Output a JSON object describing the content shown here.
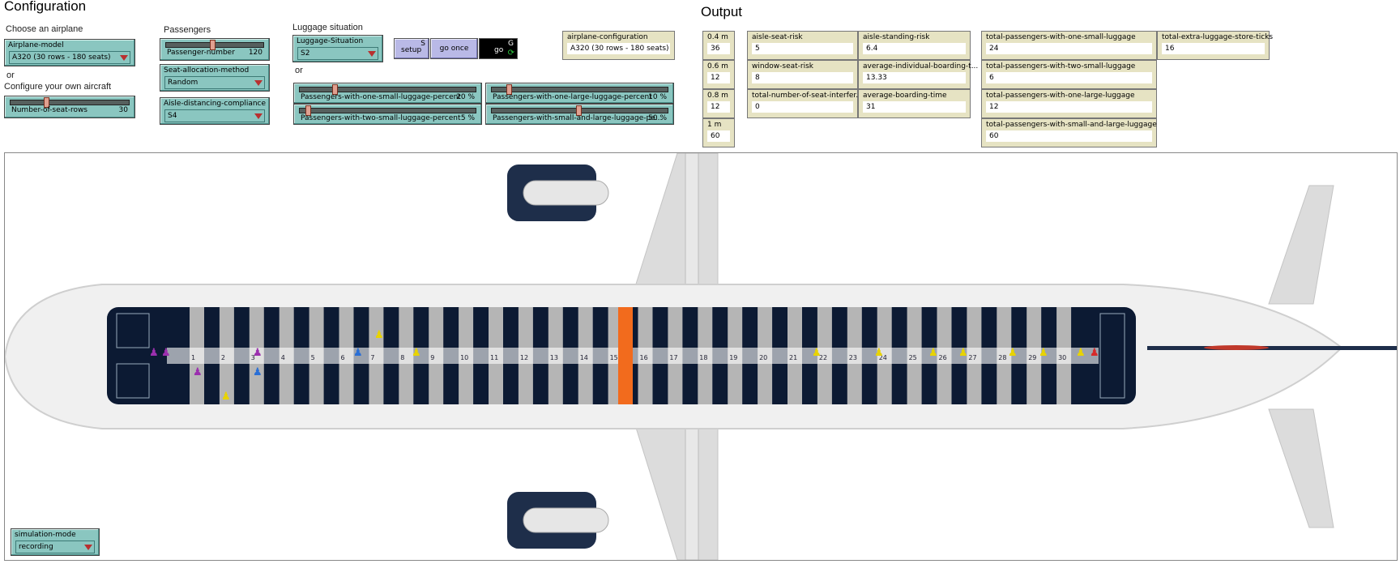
{
  "config": {
    "title": "Configuration",
    "choose_airplane_label": "Choose an airplane",
    "airplane_model": {
      "label": "Airplane-model",
      "value": "A320 (30 rows - 180 seats)"
    },
    "or_text": "or",
    "configure_label": "Configure your own aircraft",
    "rows_slider": {
      "label": "Number-of-seat-rows",
      "value": "30",
      "fraction": 0.3
    },
    "passengers_label": "Passengers",
    "passenger_slider": {
      "label": "Passenger-number",
      "value": "120",
      "fraction": 0.5
    },
    "seat_allocation": {
      "label": "Seat-allocation-method",
      "value": "Random"
    },
    "aisle_compliance": {
      "label": "Aisle-distancing-compliance",
      "value": "S4"
    },
    "luggage_label": "Luggage situation",
    "luggage_situation": {
      "label": "Luggage-Situation",
      "value": "S2"
    },
    "or_text2": "or",
    "luggage_sliders": [
      {
        "label": "Passengers-with-one-small-luggage-percent",
        "value": "20 %",
        "fraction": 0.2
      },
      {
        "label": "Passengers-with-one-large-luggage-percent",
        "value": "10 %",
        "fraction": 0.1
      },
      {
        "label": "Passengers-with-two-small-luggage-percent",
        "value": "5 %",
        "fraction": 0.05
      },
      {
        "label": "Passengers-with-small-and-large-luggage-pe...",
        "value": "50 %",
        "fraction": 0.5
      }
    ],
    "buttons": {
      "setup": "setup",
      "setup_key": "S",
      "go_once": "go once",
      "go": "go",
      "go_key": "G"
    },
    "airplane_configuration": {
      "label": "airplane-configuration",
      "value": "A320 (30 rows - 180 seats)"
    }
  },
  "output": {
    "title": "Output",
    "distance_monitors": [
      {
        "label": "0.4 m",
        "value": "36"
      },
      {
        "label": "0.6 m",
        "value": "12"
      },
      {
        "label": "0.8 m",
        "value": "12"
      },
      {
        "label": "1 m",
        "value": "60"
      }
    ],
    "risk_monitors": [
      {
        "label": "aisle-seat-risk",
        "value": "5"
      },
      {
        "label": "aisle-standing-risk",
        "value": "6.4"
      },
      {
        "label": "window-seat-risk",
        "value": "8"
      },
      {
        "label": "average-individual-boarding-t...",
        "value": "13.33"
      },
      {
        "label": "total-number-of-seat-interfer...",
        "value": "0"
      },
      {
        "label": "average-boarding-time",
        "value": "31"
      }
    ],
    "luggage_monitors": [
      {
        "label": "total-passengers-with-one-small-luggage",
        "value": "24"
      },
      {
        "label": "total-passengers-with-two-small-luggage",
        "value": "6"
      },
      {
        "label": "total-passengers-with-one-large-luggage",
        "value": "12"
      },
      {
        "label": "total-passengers-with-small-and-large-luggage",
        "value": "60"
      }
    ],
    "extra_store": {
      "label": "total-extra-luggage-store-ticks",
      "value": "16"
    }
  },
  "world": {
    "row_numbers": [
      "1",
      "2",
      "3",
      "4",
      "5",
      "6",
      "7",
      "8",
      "9",
      "10",
      "11",
      "12",
      "13",
      "14",
      "15",
      "16",
      "17",
      "18",
      "19",
      "20",
      "21",
      "22",
      "23",
      "24",
      "25",
      "26",
      "27",
      "28",
      "29",
      "30"
    ],
    "colors": {
      "seat_dark": "#0c1a33",
      "aisle_gray": "#b5b5b5",
      "exit_row": "#f26b1d",
      "engine": "#1e2e4a"
    },
    "passenger_icon": "person-icon"
  },
  "simulation_mode": {
    "label": "simulation-mode",
    "value": "recording"
  }
}
